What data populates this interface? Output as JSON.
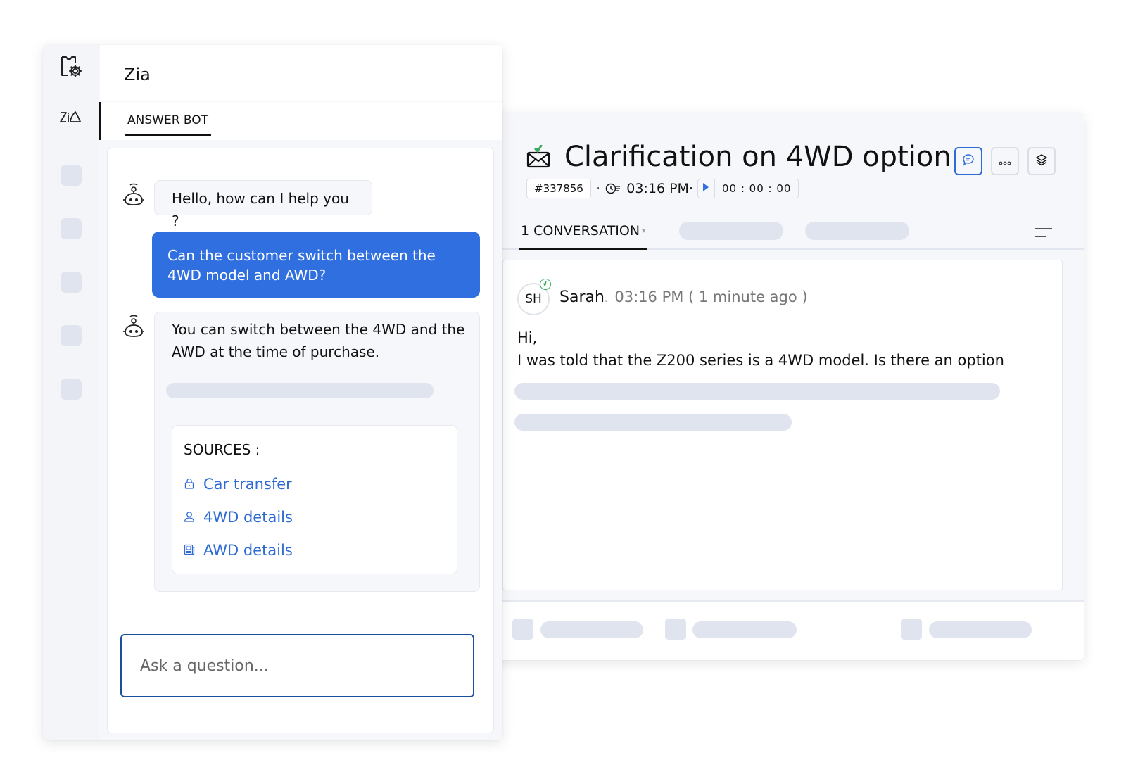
{
  "ticket": {
    "title": "Clarification on 4WD option",
    "id": "#337856",
    "separator": "·",
    "time": "03:16 PM·",
    "timer": "00 : 00 : 00",
    "tabs": [
      {
        "label": "1 CONVERSATION",
        "caret": "▾",
        "active": true
      }
    ],
    "message": {
      "avatar_initials": "SH",
      "sender": "Sarah",
      "sender_suffix": ".",
      "timestamp": "03:16 PM ( 1 minute ago )",
      "greeting": "Hi,",
      "body": "I was told that the Z200 series is a 4WD model. Is there an option"
    },
    "icons": {
      "mail": "mail-incoming-icon",
      "clock": "clock-icon",
      "play": "play-icon",
      "reply": "chat-bubble-icon",
      "more": "more-icon",
      "layers": "layers-icon",
      "menu": "menu-icon"
    }
  },
  "zia": {
    "title": "Zia",
    "tab": "ANSWER BOT",
    "rail_icons": [
      "ticket-settings-icon",
      "zia-logo-icon"
    ],
    "messages": [
      {
        "role": "bot",
        "text": "Hello, how can I help you ?"
      },
      {
        "role": "user",
        "text": "Can the customer switch between the 4WD model and AWD?"
      },
      {
        "role": "bot",
        "text": "You can switch between the 4WD and the AWD at the time of purchase."
      }
    ],
    "sources": {
      "title": "SOURCES :",
      "items": [
        {
          "label": "Car transfer",
          "icon": "lock-icon"
        },
        {
          "label": "4WD details",
          "icon": "user-icon"
        },
        {
          "label": "AWD details",
          "icon": "document-icon"
        }
      ]
    },
    "input": {
      "placeholder": "Ask a question...",
      "value": ""
    }
  },
  "colors": {
    "accent": "#2f6fe0",
    "link": "#2f6bd4",
    "input_border": "#1b4f9c",
    "skeleton": "#dfe4ee",
    "success": "#3aaa5b"
  }
}
